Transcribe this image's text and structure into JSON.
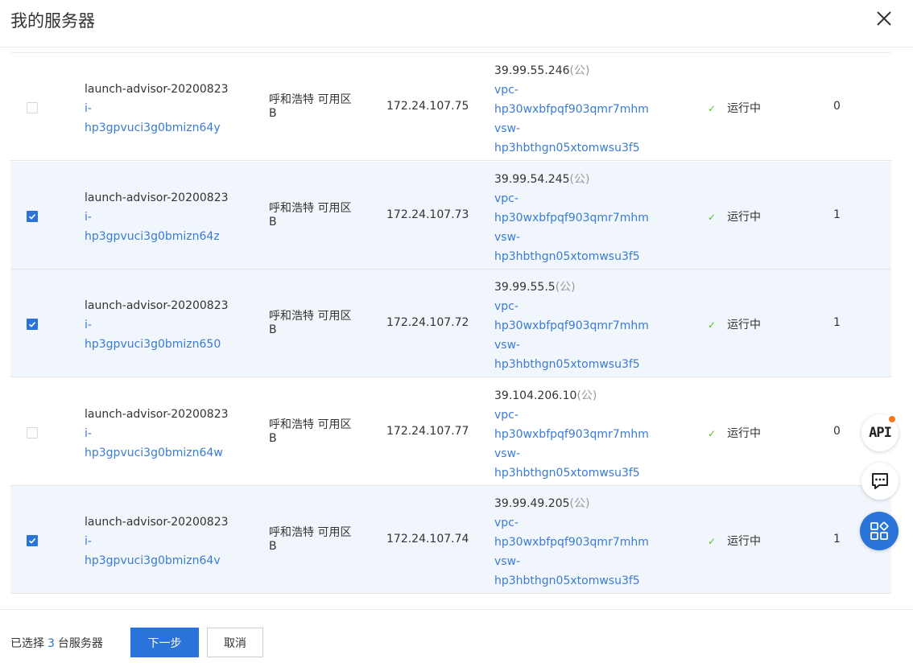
{
  "dialog": {
    "title": "我的服务器"
  },
  "rows": [
    {
      "checked": false,
      "name": "launch-advisor-20200823",
      "id_prefix": "i-",
      "id": "hp3gpvuci3g0bmizn64y",
      "zone": "呼和浩特 可用区B",
      "private_ip": "172.24.107.75",
      "public_ip": "39.99.55.246",
      "public_tag": "(公)",
      "vpc_prefix": "vpc-",
      "vpc": "hp30wxbfpqf903qmr7mhm",
      "vsw_prefix": "vsw-",
      "vsw": "hp3hbthgn05xtomwsu3f5",
      "status": "运行中",
      "count": "0"
    },
    {
      "checked": true,
      "name": "launch-advisor-20200823",
      "id_prefix": "i-",
      "id": "hp3gpvuci3g0bmizn64z",
      "zone": "呼和浩特 可用区B",
      "private_ip": "172.24.107.73",
      "public_ip": "39.99.54.245",
      "public_tag": "(公)",
      "vpc_prefix": "vpc-",
      "vpc": "hp30wxbfpqf903qmr7mhm",
      "vsw_prefix": "vsw-",
      "vsw": "hp3hbthgn05xtomwsu3f5",
      "status": "运行中",
      "count": "1"
    },
    {
      "checked": true,
      "name": "launch-advisor-20200823",
      "id_prefix": "i-",
      "id": "hp3gpvuci3g0bmizn650",
      "zone": "呼和浩特 可用区B",
      "private_ip": "172.24.107.72",
      "public_ip": "39.99.55.5",
      "public_tag": "(公)",
      "vpc_prefix": "vpc-",
      "vpc": "hp30wxbfpqf903qmr7mhm",
      "vsw_prefix": "vsw-",
      "vsw": "hp3hbthgn05xtomwsu3f5",
      "status": "运行中",
      "count": "1"
    },
    {
      "checked": false,
      "name": "launch-advisor-20200823",
      "id_prefix": "i-",
      "id": "hp3gpvuci3g0bmizn64w",
      "zone": "呼和浩特 可用区B",
      "private_ip": "172.24.107.77",
      "public_ip": "39.104.206.10",
      "public_tag": "(公)",
      "vpc_prefix": "vpc-",
      "vpc": "hp30wxbfpqf903qmr7mhm",
      "vsw_prefix": "vsw-",
      "vsw": "hp3hbthgn05xtomwsu3f5",
      "status": "运行中",
      "count": "0"
    },
    {
      "checked": true,
      "name": "launch-advisor-20200823",
      "id_prefix": "i-",
      "id": "hp3gpvuci3g0bmizn64v",
      "zone": "呼和浩特 可用区B",
      "private_ip": "172.24.107.74",
      "public_ip": "39.99.49.205",
      "public_tag": "(公)",
      "vpc_prefix": "vpc-",
      "vpc": "hp30wxbfpqf903qmr7mhm",
      "vsw_prefix": "vsw-",
      "vsw": "hp3hbthgn05xtomwsu3f5",
      "status": "运行中",
      "count": "1"
    }
  ],
  "footer": {
    "selected_prefix": "已选择",
    "selected_count": "3",
    "selected_suffix": "台服务器",
    "next_label": "下一步",
    "cancel_label": "取消"
  },
  "floating": {
    "api_label": "API",
    "notification_dot_color": "#f07a1e"
  },
  "colors": {
    "accent": "#2a73d9",
    "link": "#3a7bd5",
    "selected_row": "#f1f6fc",
    "status_ok": "#52c41a"
  },
  "icons": {
    "close": "close-icon",
    "check": "check-icon",
    "chat": "chat-icon",
    "apps": "apps-grid-icon"
  }
}
